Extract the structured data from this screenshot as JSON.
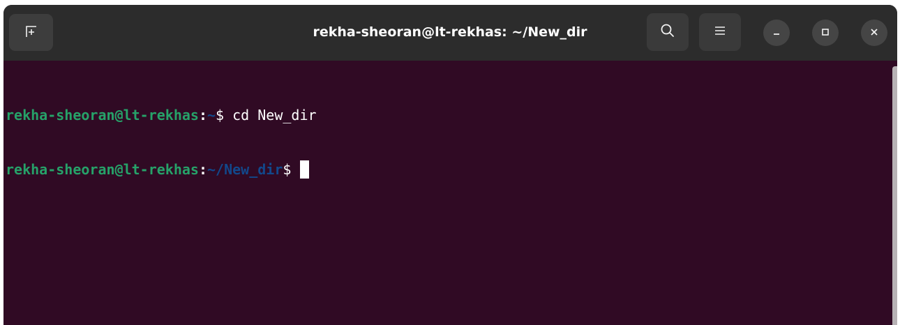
{
  "window": {
    "title": "rekha-sheoran@lt-rekhas: ~/New_dir"
  },
  "titlebar": {
    "buttons": [
      {
        "name": "new-tab",
        "icon": "new-tab-icon"
      },
      {
        "name": "search",
        "icon": "search-icon"
      },
      {
        "name": "menu",
        "icon": "hamburger-menu-icon"
      },
      {
        "name": "minimize",
        "icon": "minimize-icon"
      },
      {
        "name": "maximize",
        "icon": "maximize-icon"
      },
      {
        "name": "close",
        "icon": "close-icon"
      }
    ]
  },
  "terminal": {
    "lines": [
      {
        "user_host": "rekha-sheoran@lt-rekhas",
        "colon": ":",
        "path": "~",
        "prompt": "$",
        "command": " cd New_dir"
      },
      {
        "user_host": "rekha-sheoran@lt-rekhas",
        "colon": ":",
        "path": "~/New_dir",
        "prompt": "$",
        "command": " "
      }
    ]
  },
  "colors": {
    "terminal_bg": "#300a24",
    "user_host": "#26a269",
    "path": "#12488b",
    "titlebar_bg": "#2c2c2c"
  }
}
